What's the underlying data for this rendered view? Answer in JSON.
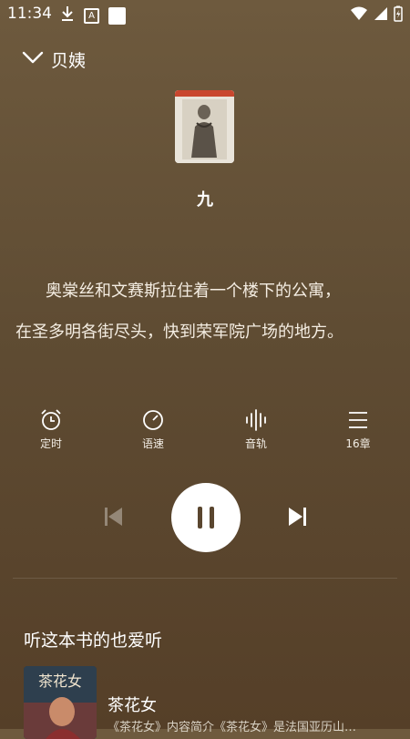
{
  "status_bar": {
    "time": "11:34",
    "a_badge": "A"
  },
  "header": {
    "title": "贝姨"
  },
  "now_playing": {
    "chapter_title": "九"
  },
  "text": {
    "line1": "奥棠丝和文赛斯拉住着一个楼下的公寓，",
    "line2": "在圣多明各街尽头，快到荣军院广场的地方。"
  },
  "controls": {
    "timer_label": "定时",
    "speed_label": "语速",
    "track_label": "音轨",
    "chapters_label": "16章"
  },
  "player": {
    "state": "playing"
  },
  "recommend": {
    "section_title": "听这本书的也爱听",
    "items": [
      {
        "title": "茶花女",
        "description": "《茶花女》内容简介《茶花女》是法国亚历山…",
        "cover_text": "茶花女"
      }
    ]
  }
}
